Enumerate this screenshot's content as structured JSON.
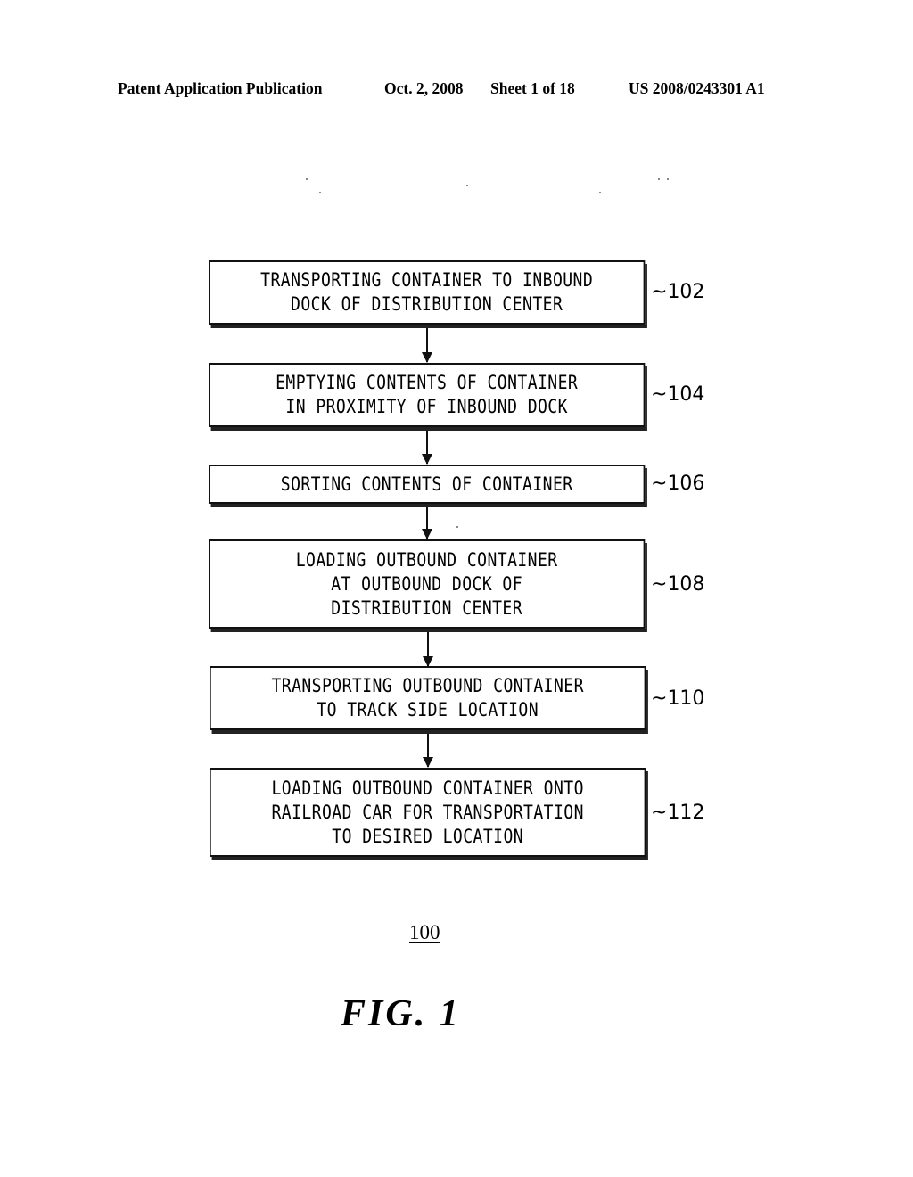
{
  "header": {
    "publication": "Patent Application Publication",
    "date": "Oct. 2, 2008",
    "sheet": "Sheet 1 of 18",
    "patent_number": "US 2008/0243301 A1"
  },
  "flowchart": {
    "steps": [
      {
        "ref": "102",
        "text": "TRANSPORTING CONTAINER TO INBOUND\nDOCK OF DISTRIBUTION CENTER"
      },
      {
        "ref": "104",
        "text": "EMPTYING CONTENTS OF CONTAINER\nIN PROXIMITY OF INBOUND DOCK"
      },
      {
        "ref": "106",
        "text": "SORTING CONTENTS OF CONTAINER"
      },
      {
        "ref": "108",
        "text": "LOADING OUTBOUND CONTAINER\nAT OUTBOUND DOCK OF\nDISTRIBUTION CENTER"
      },
      {
        "ref": "110",
        "text": "TRANSPORTING OUTBOUND CONTAINER\nTO TRACK SIDE LOCATION"
      },
      {
        "ref": "112",
        "text": "LOADING OUTBOUND CONTAINER ONTO\nRAILROAD CAR FOR TRANSPORTATION\nTO DESIRED LOCATION"
      }
    ],
    "tilde": "~"
  },
  "figure": {
    "reference": "100",
    "label": "FIG. 1"
  }
}
